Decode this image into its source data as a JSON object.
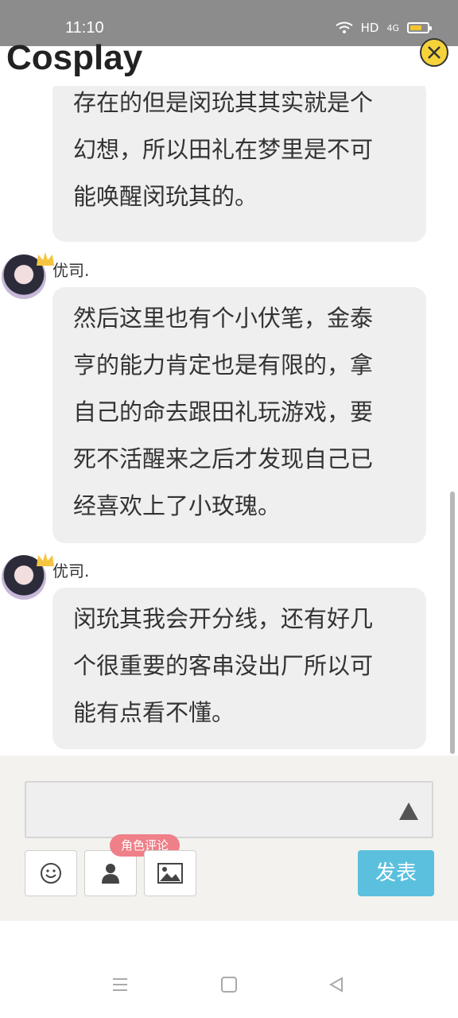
{
  "status_bar": {
    "time": "11:10",
    "network": "HD",
    "signal": "4G"
  },
  "header": {
    "title": "Cosplay"
  },
  "messages": [
    {
      "lines": [
        "存在的但是闵玧其其实就是个",
        "幻想，所以田礼在梦里是不可",
        "能唤醒闵玧其的。"
      ]
    },
    {
      "user": "优司.",
      "lines": [
        "然后这里也有个小伏笔，金泰",
        "亨的能力肯定也是有限的，拿",
        "自己的命去跟田礼玩游戏，要",
        "死不活醒来之后才发现自己已",
        "经喜欢上了小玫瑰。"
      ]
    },
    {
      "user": "优司.",
      "lines": [
        "闵玧其我会开分线，还有好几",
        "个很重要的客串没出厂所以可",
        "能有点看不懂。"
      ]
    }
  ],
  "composer": {
    "role_tag": "角色评论",
    "send_label": "发表"
  },
  "colors": {
    "send": "#5bc0de",
    "tag": "#ef7f88",
    "close": "#f6d33b"
  }
}
